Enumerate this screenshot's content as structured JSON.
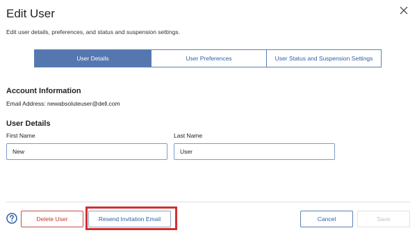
{
  "dialog": {
    "title": "Edit User",
    "subtitle": "Edit user details, preferences, and status and suspension settings."
  },
  "tabs": [
    {
      "label": "User Details",
      "active": true
    },
    {
      "label": "User Preferences",
      "active": false
    },
    {
      "label": "User Status and Suspension Settings",
      "active": false
    }
  ],
  "account": {
    "heading": "Account Information",
    "email_line": "Email Address: newabsoluteuser@dell.com"
  },
  "details": {
    "heading": "User Details",
    "first_name_label": "First Name",
    "first_name_value": "New",
    "last_name_label": "Last Name",
    "last_name_value": "User"
  },
  "footer": {
    "delete_label": "Delete User",
    "resend_label": "Resend Invitation Email",
    "cancel_label": "Cancel",
    "save_label": "Save"
  },
  "icons": {
    "close": "close-icon",
    "help": "help-icon"
  },
  "colors": {
    "accent": "#5577b0",
    "danger": "#c0392b",
    "highlight": "#d32f2f"
  }
}
